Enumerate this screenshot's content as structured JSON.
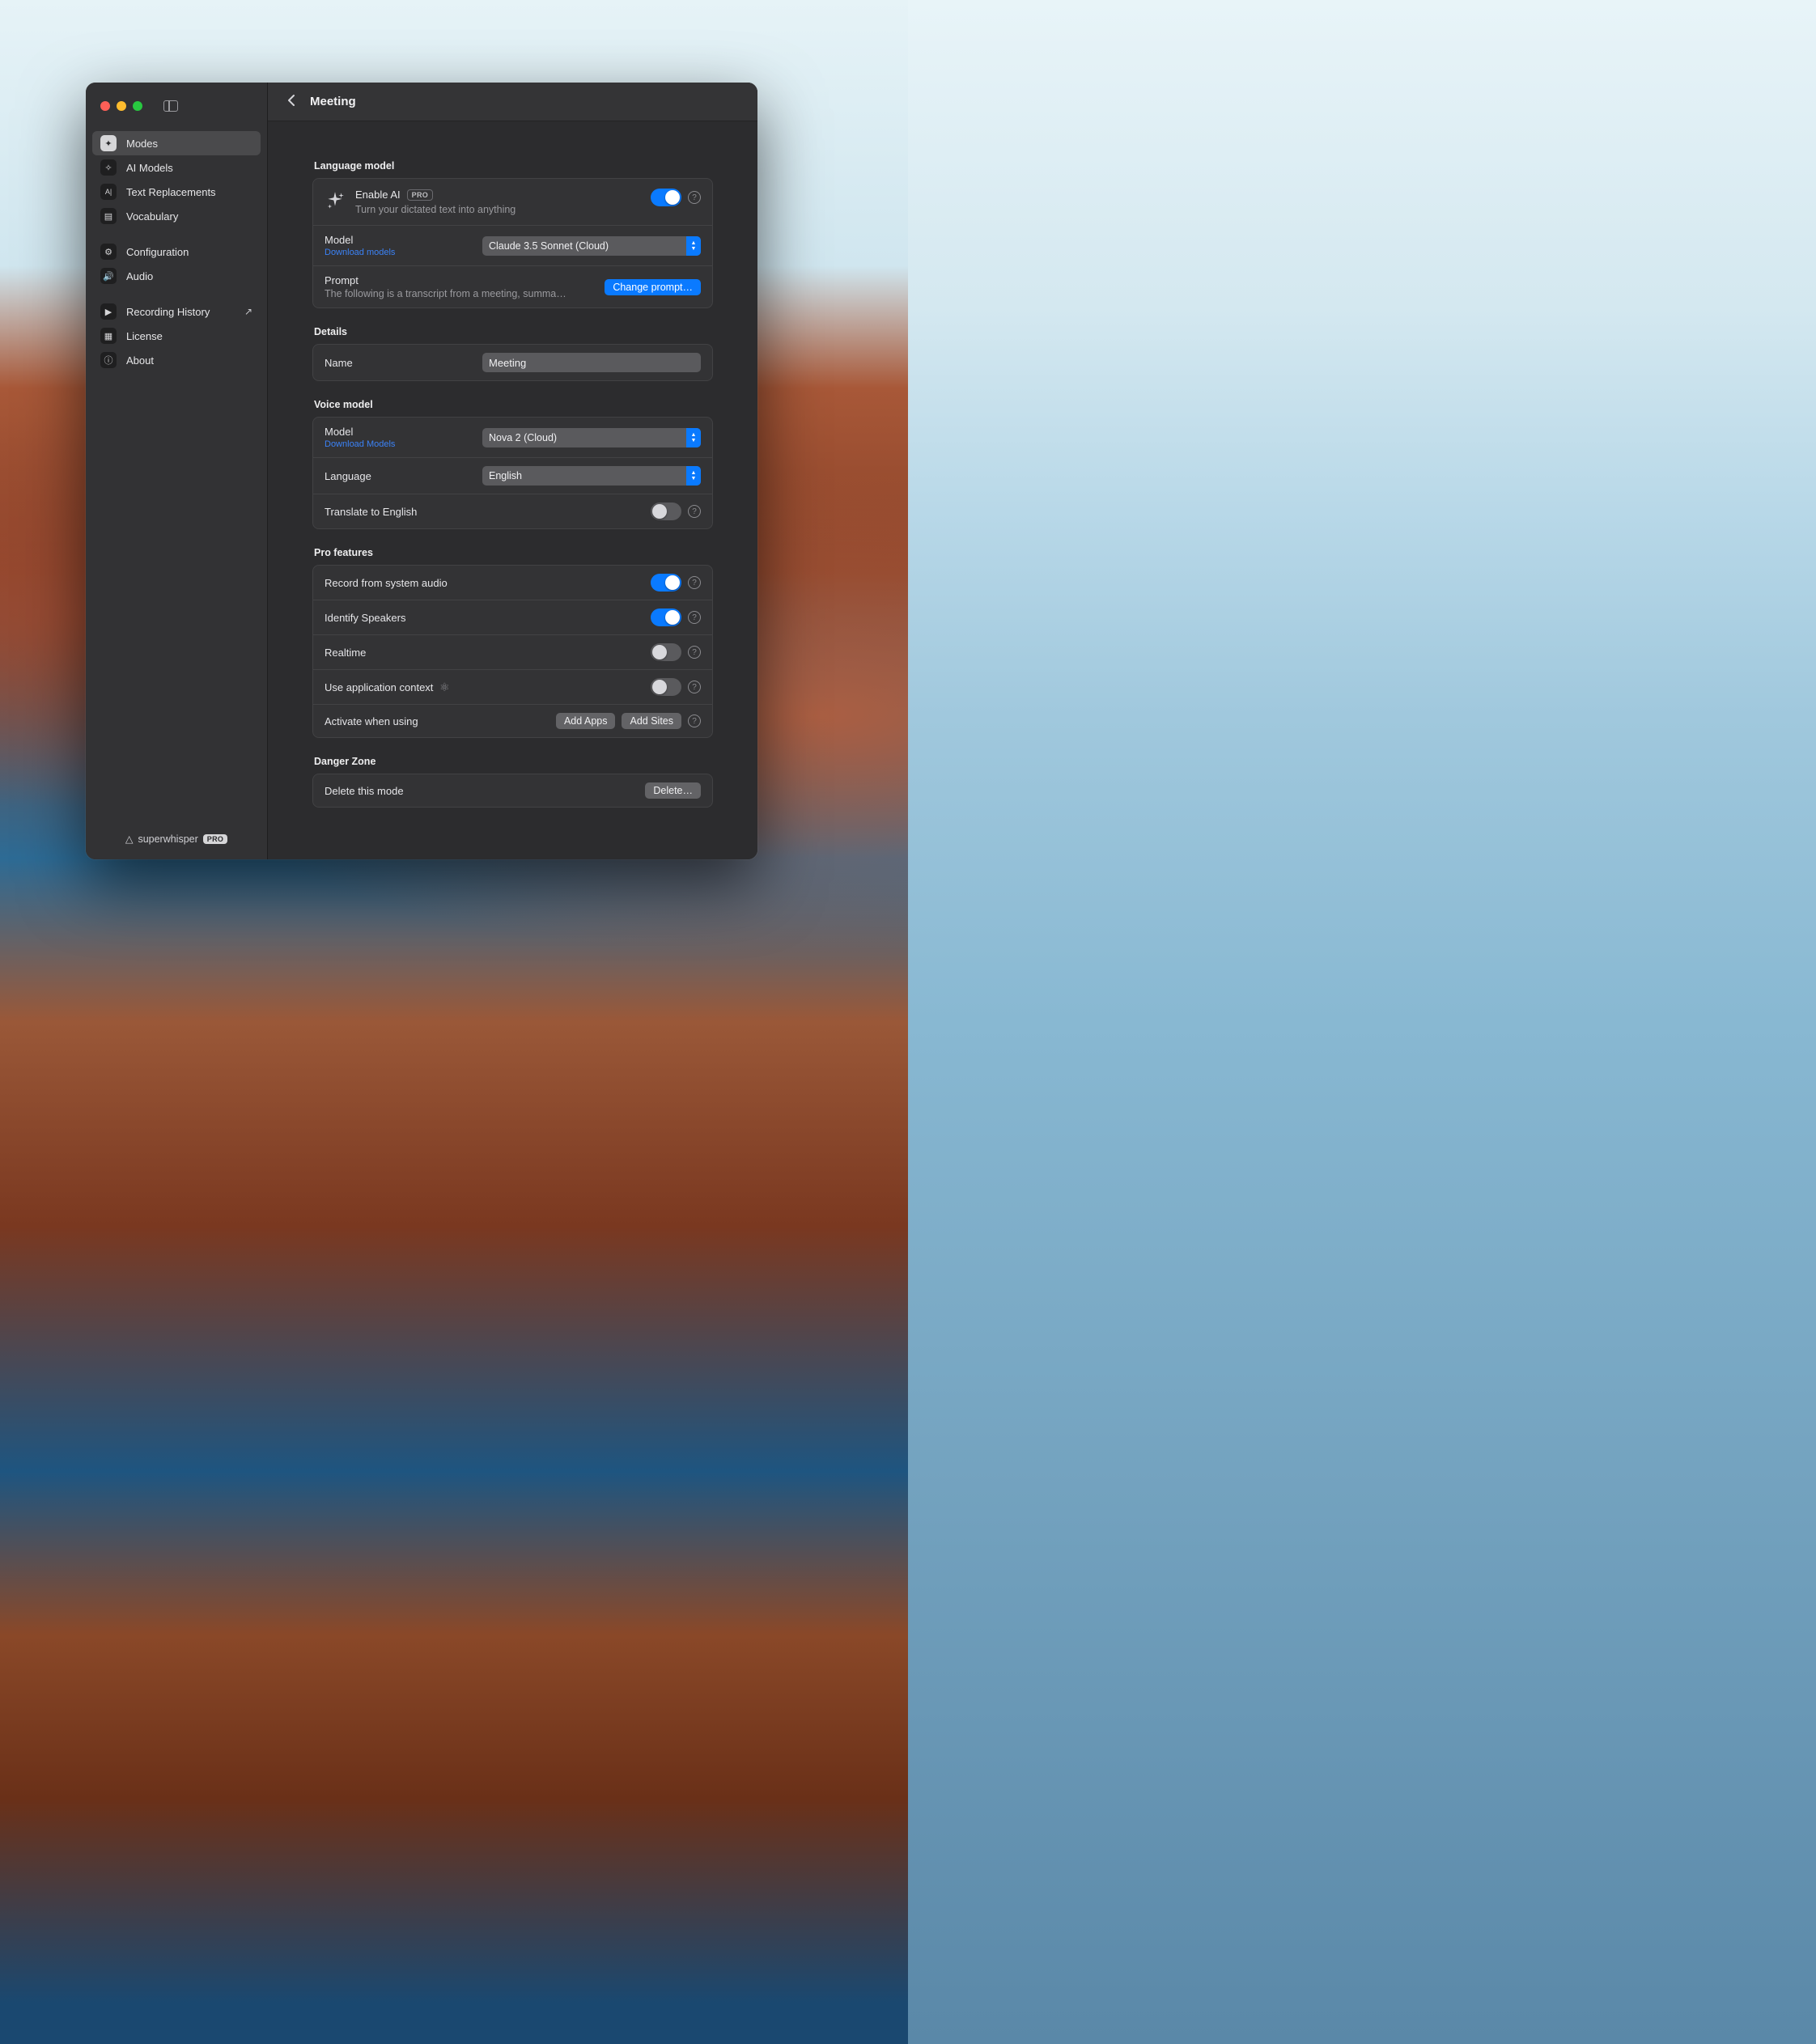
{
  "header": {
    "title": "Meeting"
  },
  "sidebar": {
    "items": [
      {
        "label": "Modes"
      },
      {
        "label": "AI Models"
      },
      {
        "label": "Text Replacements"
      },
      {
        "label": "Vocabulary"
      },
      {
        "label": "Configuration"
      },
      {
        "label": "Audio"
      },
      {
        "label": "Recording History"
      },
      {
        "label": "License"
      },
      {
        "label": "About"
      }
    ],
    "footer": {
      "brand": "superwhisper",
      "badge": "PRO"
    }
  },
  "sections": {
    "language_model": {
      "title": "Language model",
      "enable_ai": {
        "label": "Enable AI",
        "badge": "PRO",
        "desc": "Turn your dictated text into anything",
        "on": true
      },
      "model": {
        "label": "Model",
        "link": "Download models",
        "value": "Claude 3.5 Sonnet (Cloud)"
      },
      "prompt": {
        "label": "Prompt",
        "preview": "The following is a transcript from a meeting, summa…",
        "button": "Change prompt…"
      }
    },
    "details": {
      "title": "Details",
      "name": {
        "label": "Name",
        "value": "Meeting"
      }
    },
    "voice_model": {
      "title": "Voice model",
      "model": {
        "label": "Model",
        "link": "Download Models",
        "value": "Nova 2 (Cloud)"
      },
      "language": {
        "label": "Language",
        "value": "English"
      },
      "translate": {
        "label": "Translate to English",
        "on": false
      }
    },
    "pro_features": {
      "title": "Pro features",
      "record_sys": {
        "label": "Record from system audio",
        "on": true
      },
      "identify": {
        "label": "Identify Speakers",
        "on": true
      },
      "realtime": {
        "label": "Realtime",
        "on": false
      },
      "context": {
        "label": "Use application context",
        "on": false
      },
      "activate": {
        "label": "Activate when using",
        "add_apps": "Add Apps",
        "add_sites": "Add Sites"
      }
    },
    "danger": {
      "title": "Danger Zone",
      "delete": {
        "label": "Delete this mode",
        "button": "Delete…"
      }
    }
  }
}
